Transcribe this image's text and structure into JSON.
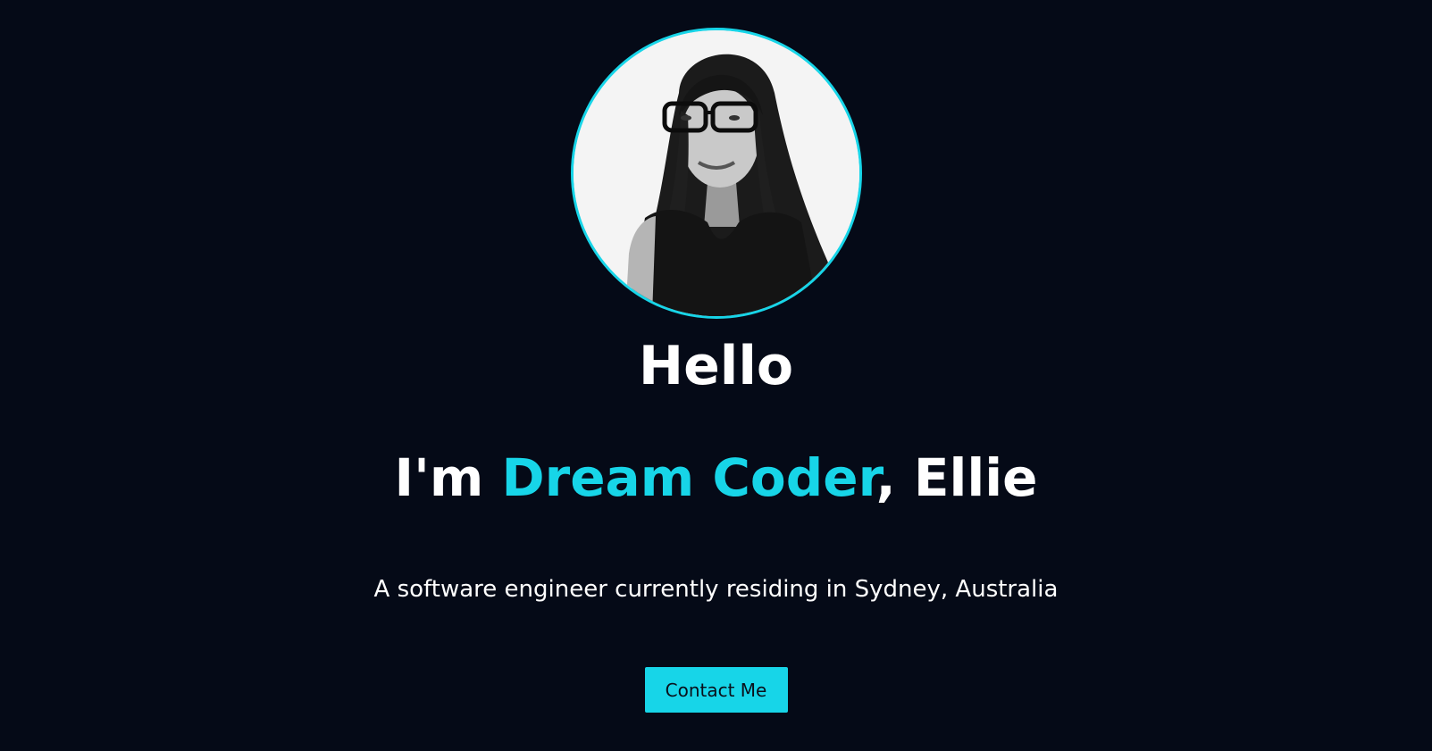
{
  "hero": {
    "greeting": "Hello",
    "intro_prefix": "I'm ",
    "intro_highlight": "Dream Coder",
    "intro_suffix": ", Ellie",
    "tagline": "A software engineer currently residing in Sydney, Australia",
    "contact_label": "Contact Me",
    "avatar_icon": "profile-photo"
  },
  "colors": {
    "background": "#050a17",
    "accent": "#17d5e8",
    "text": "#ffffff"
  }
}
